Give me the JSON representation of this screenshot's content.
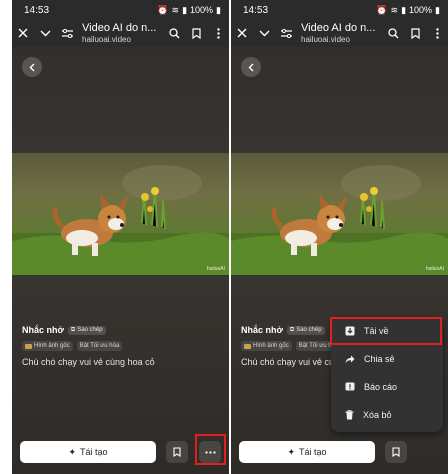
{
  "status": {
    "time": "14:53",
    "battery": "100%"
  },
  "browser": {
    "title": "Video AI do n...",
    "url": "hailuoai.video"
  },
  "image": {
    "watermark": "hailuoAI"
  },
  "post": {
    "title": "Nhắc nhở",
    "copy_label": "Sao chép",
    "tags": [
      "Hình ảnh gốc",
      "Bật Tối ưu hóa"
    ],
    "prompt": "Chú chó chạy vui vẻ cùng hoa cỏ"
  },
  "actions": {
    "regenerate_label": "Tái tạo"
  },
  "menu": {
    "items": [
      {
        "label": "Tải về",
        "icon": "download-icon"
      },
      {
        "label": "Chia sẻ",
        "icon": "share-icon"
      },
      {
        "label": "Báo cáo",
        "icon": "report-icon"
      },
      {
        "label": "Xóa bỏ",
        "icon": "trash-icon"
      }
    ]
  },
  "colors": {
    "highlight": "#e02020",
    "background": "#2b2b2b",
    "menu_bg": "#333233"
  }
}
